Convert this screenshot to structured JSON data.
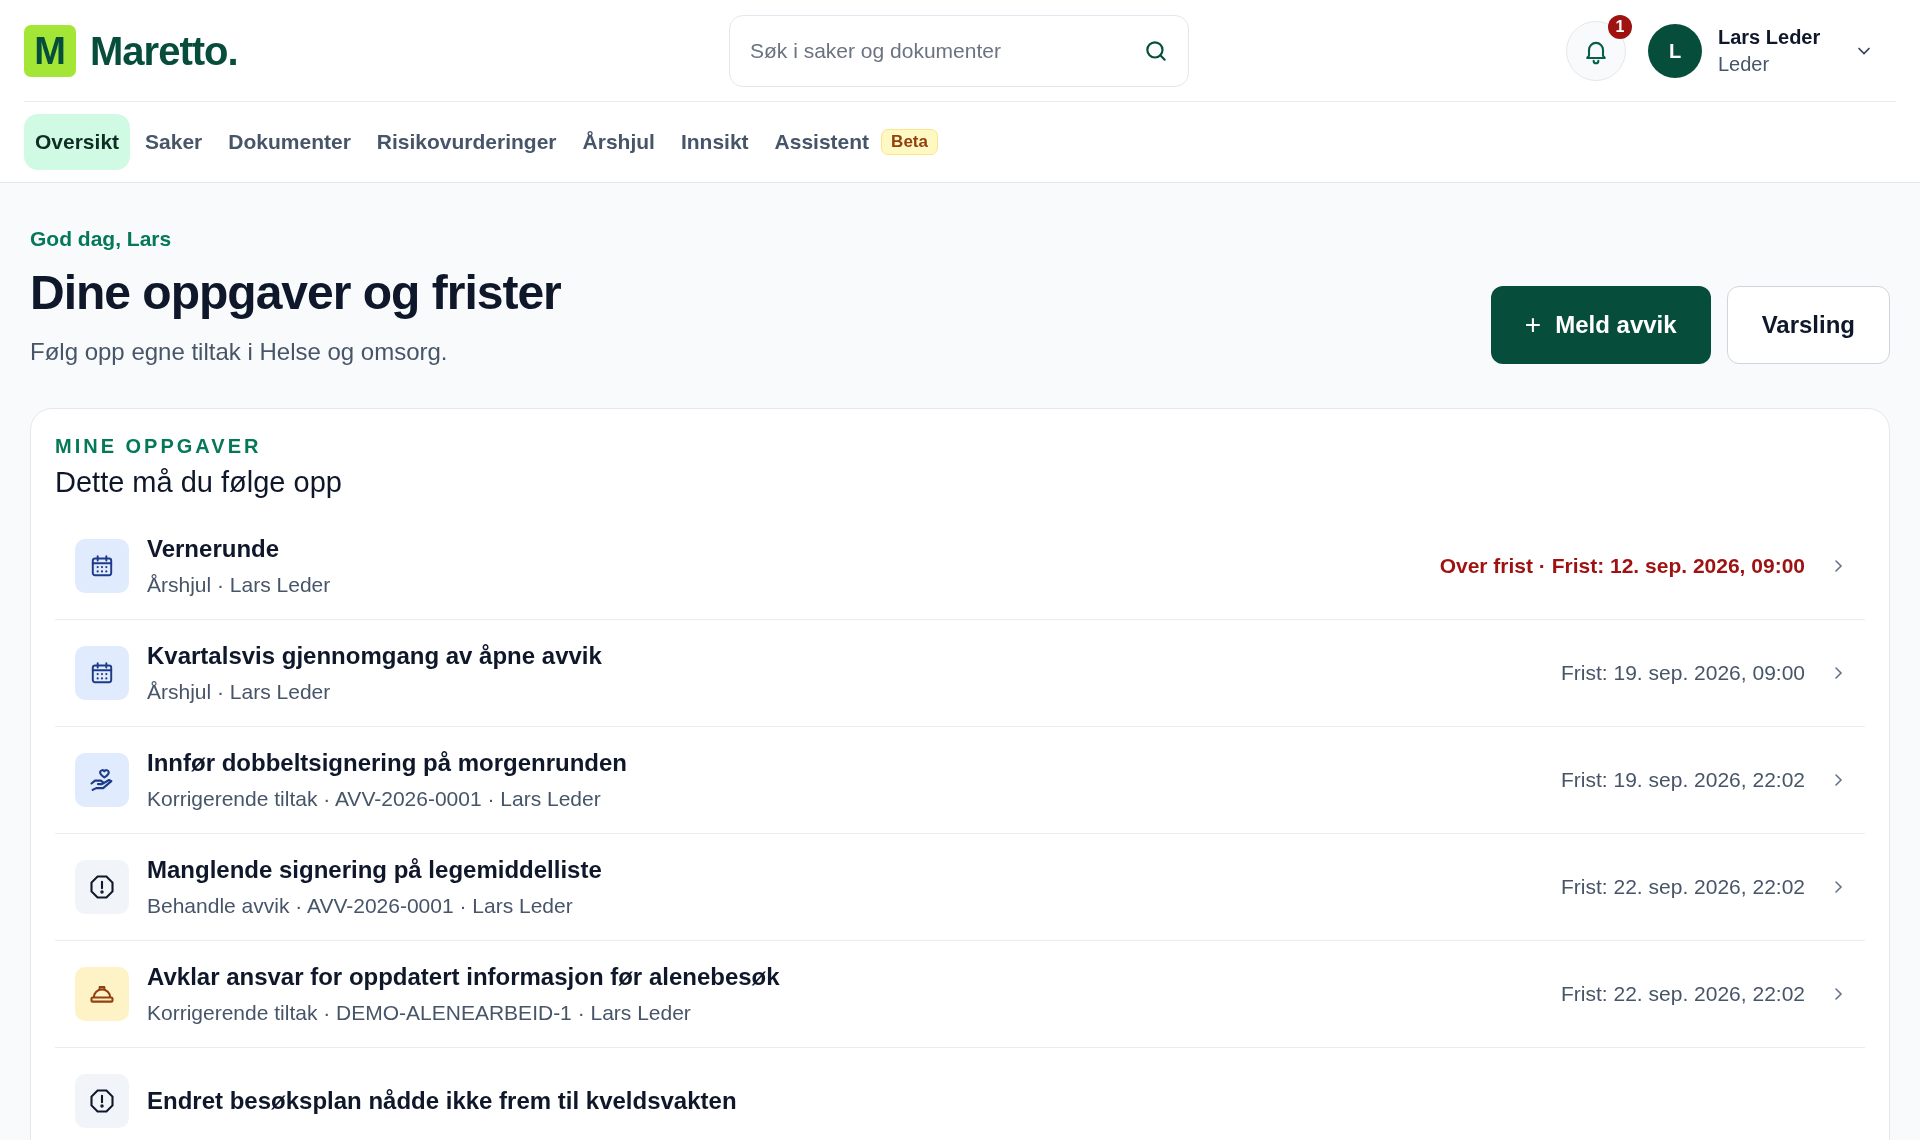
{
  "brand": {
    "mark": "M",
    "name": "Maretto."
  },
  "search": {
    "placeholder": "Søk i saker og dokumenter"
  },
  "notifications": {
    "count": "1"
  },
  "user": {
    "initial": "L",
    "name": "Lars Leder",
    "role": "Leder"
  },
  "tabs": [
    {
      "label": "Oversikt",
      "selected": true
    },
    {
      "label": "Saker",
      "selected": false
    },
    {
      "label": "Dokumenter",
      "selected": false
    },
    {
      "label": "Risikovurderinger",
      "selected": false
    },
    {
      "label": "Årshjul",
      "selected": false
    },
    {
      "label": "Innsikt",
      "selected": false
    },
    {
      "label": "Assistent",
      "selected": false,
      "badge": "Beta"
    }
  ],
  "greeting": "God dag, Lars",
  "title": "Dine oppgaver og frister",
  "subtitle": "Følg opp egne tiltak i Helse og omsorg.",
  "actions": [
    {
      "label": "Meld avvik",
      "kind": "primary",
      "icon": "+"
    },
    {
      "label": "Varsling",
      "kind": "secondary"
    }
  ],
  "tasks_card": {
    "eyebrow": "MINE OPPGAVER",
    "heading": "Dette må du følge opp",
    "items": [
      {
        "kind": "calendar",
        "title": "Vernerunde",
        "meta": "Årshjul · Lars Leder",
        "due": "Over frist · Frist: 12. sep. 2026, 09:00",
        "overdue": true
      },
      {
        "kind": "calendar",
        "title": "Kvartalsvis gjennomgang av åpne avvik",
        "meta": "Årshjul · Lars Leder",
        "due": "Frist: 19. sep. 2026, 09:00",
        "overdue": false
      },
      {
        "kind": "care",
        "title": "Innfør dobbeltsignering på morgenrunden",
        "meta": "Korrigerende tiltak · AVV-2026-0001 · Lars Leder",
        "due": "Frist: 19. sep. 2026, 22:02",
        "overdue": false
      },
      {
        "kind": "alert",
        "title": "Manglende signering på legemiddelliste",
        "meta": "Behandle avvik · AVV-2026-0001 · Lars Leder",
        "due": "Frist: 22. sep. 2026, 22:02",
        "overdue": false
      },
      {
        "kind": "helmet",
        "title": "Avklar ansvar for oppdatert informasjon før alenebesøk",
        "meta": "Korrigerende tiltak · DEMO-ALENEARBEID-1 · Lars Leder",
        "due": "Frist: 22. sep. 2026, 22:02",
        "overdue": false
      },
      {
        "kind": "alert",
        "title": "Endret besøksplan nådde ikke frem til kveldsvakten"
      }
    ]
  }
}
